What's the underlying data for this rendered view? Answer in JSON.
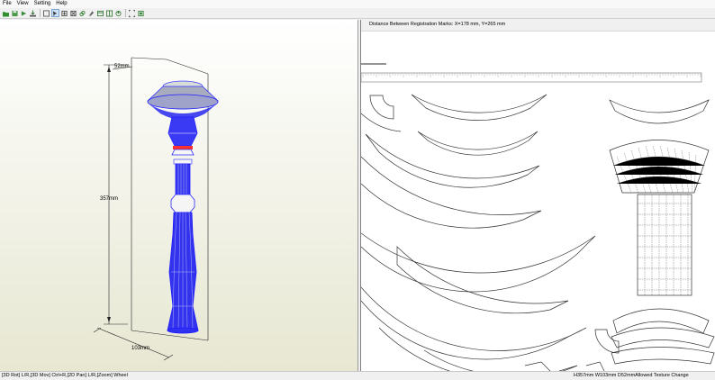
{
  "menu": {
    "items": [
      "File",
      "View",
      "Setting",
      "Help"
    ]
  },
  "toolbar": {
    "icons": [
      "open-icon",
      "save-icon",
      "export-icon",
      "print-icon",
      "select-icon",
      "join-icon",
      "move-icon",
      "rotate-icon",
      "link-icon",
      "paint-icon",
      "frame-icon",
      "texture-icon",
      "reset-icon",
      "fit-icon",
      "zoom-icon"
    ]
  },
  "view3d": {
    "dim_top": "52mm",
    "dim_height": "357mm",
    "dim_width": "103mm"
  },
  "view2d": {
    "header": "Distance Between Registration Marks: X=178 mm, Y=265 mm"
  },
  "status": {
    "left": "[3D Rot] L/R,[3D Mov] Ctrl+R,[2D Pan] L/R,[Zoom] Wheel",
    "right": "H357mm W103mm D52mmAllowed Texture Change"
  }
}
